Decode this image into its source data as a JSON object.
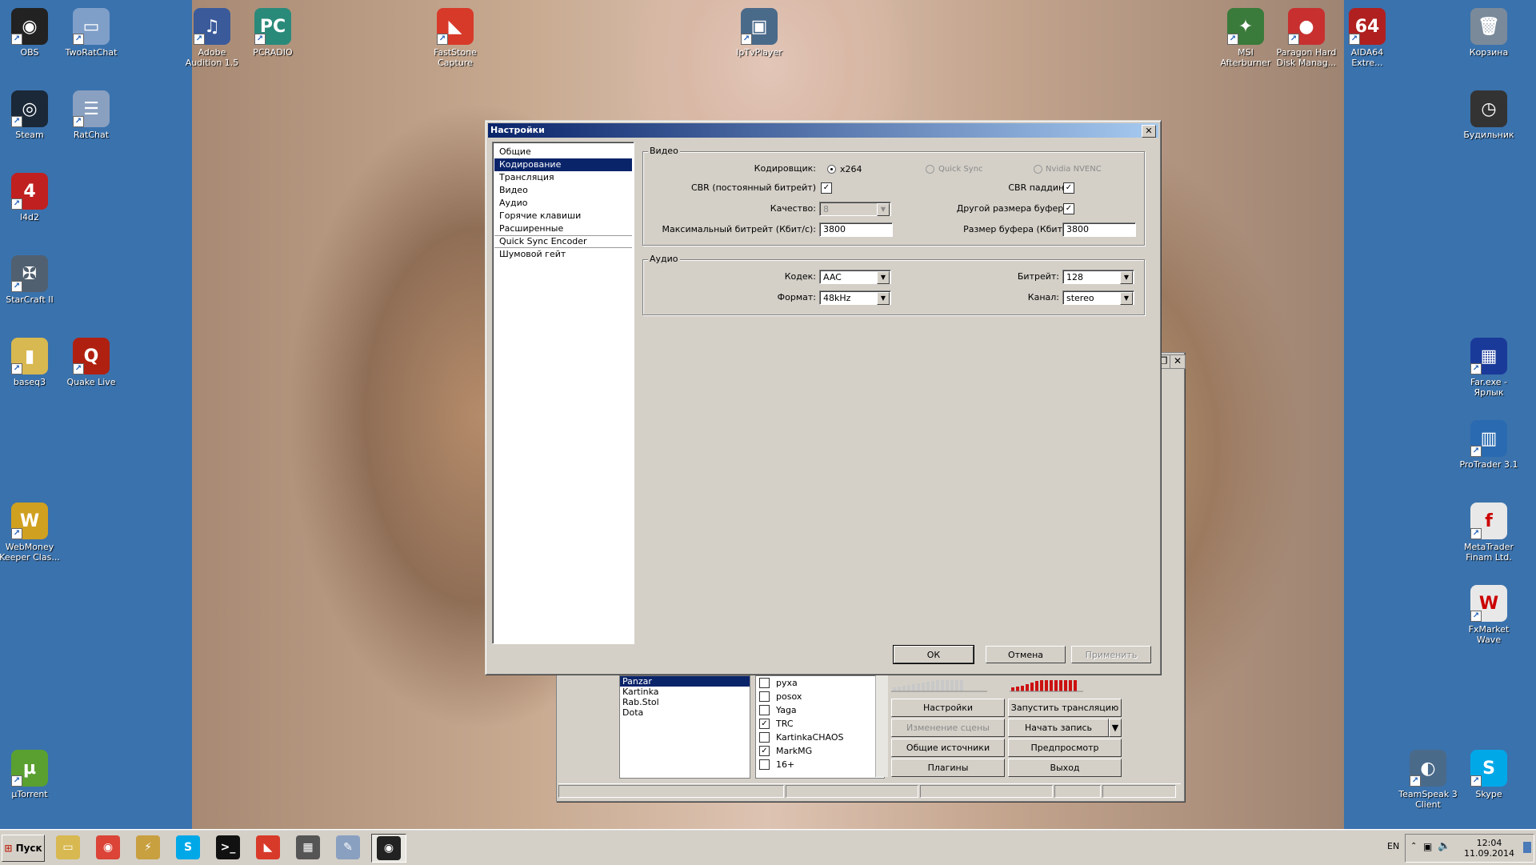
{
  "desktop": {
    "icons": [
      {
        "label": "OBS",
        "color": "#222222",
        "glyph": "◉"
      },
      {
        "label": "TwoRatChat",
        "color": "#7f9fc9",
        "glyph": "▭"
      },
      {
        "label": "Adobe Audition 1.5",
        "color": "#3a5a9a",
        "glyph": "♫"
      },
      {
        "label": "PCRADIO",
        "color": "#2a8a7a",
        "glyph": "PC"
      },
      {
        "label": "FastStone Capture",
        "color": "#d83a2a",
        "glyph": "◣"
      },
      {
        "label": "IpTvPlayer",
        "color": "#4a6a8a",
        "glyph": "▣"
      },
      {
        "label": "MSI Afterburner",
        "color": "#3a7a3a",
        "glyph": "✦"
      },
      {
        "label": "Paragon Hard Disk Manag...",
        "color": "#c83030",
        "glyph": "●"
      },
      {
        "label": "AIDA64 Extre...",
        "color": "#b02020",
        "glyph": "64"
      },
      {
        "label": "Корзина",
        "color": "#7a8a9a",
        "glyph": "🗑"
      },
      {
        "label": "Steam",
        "color": "#1b2838",
        "glyph": "◎"
      },
      {
        "label": "RatChat",
        "color": "#8aa0c0",
        "glyph": "☰"
      },
      {
        "label": "Будильник",
        "color": "#333333",
        "glyph": "◷"
      },
      {
        "label": "l4d2",
        "color": "#c02020",
        "glyph": "4"
      },
      {
        "label": "StarCraft II",
        "color": "#506070",
        "glyph": "✠"
      },
      {
        "label": "baseq3",
        "color": "#d8b850",
        "glyph": "▮"
      },
      {
        "label": "Quake Live",
        "color": "#b02010",
        "glyph": "Q"
      },
      {
        "label": "Far.exe - Ярлык",
        "color": "#1a3a9a",
        "glyph": "▦"
      },
      {
        "label": "ProTrader 3.1",
        "color": "#2a6ab0",
        "glyph": "▥"
      },
      {
        "label": "WebMoney Keeper Clas...",
        "color": "#d0a020",
        "glyph": "W"
      },
      {
        "label": "MetaTrader Finam Ltd.",
        "color": "#e8e8e8",
        "glyph": "f"
      },
      {
        "label": "FxMarket Wave",
        "color": "#e8e8e8",
        "glyph": "W"
      },
      {
        "label": "µTorrent",
        "color": "#5aa030",
        "glyph": "µ"
      },
      {
        "label": "TeamSpeak 3 Client",
        "color": "#4a6a8a",
        "glyph": "◐"
      },
      {
        "label": "Skype",
        "color": "#00a8e8",
        "glyph": "S"
      }
    ]
  },
  "obs": {
    "scenes": [
      "Panzar",
      "Kartinka",
      "Rab.Stol",
      "Dota"
    ],
    "sources": [
      {
        "label": "руха",
        "checked": false
      },
      {
        "label": "posox",
        "checked": false
      },
      {
        "label": "Yaga",
        "checked": false
      },
      {
        "label": "TRC",
        "checked": true
      },
      {
        "label": "KartinkaCHAOS",
        "checked": false
      },
      {
        "label": "MarkMG",
        "checked": true
      },
      {
        "label": "16+",
        "checked": false
      }
    ],
    "buttons": {
      "settings": "Настройки",
      "start_stream": "Запустить трансляцию",
      "edit_scene": "Изменение сцены",
      "start_record": "Начать запись",
      "global_sources": "Общие источники",
      "preview": "Предпросмотр",
      "plugins": "Плагины",
      "exit": "Выход"
    }
  },
  "dialog": {
    "title": "Настройки",
    "nav": [
      "Общие",
      "Кодирование",
      "Трансляция",
      "Видео",
      "Аудио",
      "Горячие клавиши",
      "Расширенные",
      "Quick Sync Encoder",
      "Шумовой гейт"
    ],
    "selected_nav": "Кодирование",
    "video": {
      "legend": "Видео",
      "encoder_label": "Кодировщик:",
      "encoder_options": [
        "x264",
        "Quick Sync",
        "Nvidia NVENC"
      ],
      "encoder_selected": "x264",
      "cbr_label": "CBR (постоянный битрейт)",
      "cbr_checked": true,
      "cbr_padding_label": "CBR паддинг",
      "cbr_padding_checked": true,
      "quality_label": "Качество:",
      "quality_value": "8",
      "custom_buffer_label": "Другой размера буфера",
      "custom_buffer_checked": true,
      "max_bitrate_label": "Максимальный битрейт (Кбит/с):",
      "max_bitrate_value": "3800",
      "buffer_size_label": "Размер буфера (Кбит):",
      "buffer_size_value": "3800"
    },
    "audio": {
      "legend": "Аудио",
      "codec_label": "Кодек:",
      "codec_value": "AAC",
      "bitrate_label": "Битрейт:",
      "bitrate_value": "128",
      "format_label": "Формат:",
      "format_value": "48kHz",
      "channel_label": "Канал:",
      "channel_value": "stereo"
    },
    "buttons": {
      "ok": "ОК",
      "cancel": "Отмена",
      "apply": "Применить"
    }
  },
  "taskbar": {
    "start_label": "Пуск",
    "apps": [
      {
        "name": "explorer",
        "color": "#d8b850",
        "glyph": "▭"
      },
      {
        "name": "chrome",
        "color": "#db4437",
        "glyph": "◉"
      },
      {
        "name": "winamp",
        "color": "#c8a040",
        "glyph": "⚡"
      },
      {
        "name": "skype",
        "color": "#00a8e8",
        "glyph": "S"
      },
      {
        "name": "cmd",
        "color": "#111111",
        "glyph": ">_"
      },
      {
        "name": "faststone",
        "color": "#d83a2a",
        "glyph": "◣"
      },
      {
        "name": "media-player",
        "color": "#555555",
        "glyph": "▦"
      },
      {
        "name": "paint",
        "color": "#8aa0c0",
        "glyph": "✎"
      },
      {
        "name": "obs",
        "color": "#222222",
        "glyph": "◉"
      }
    ],
    "lang": "EN",
    "time": "12:04",
    "date": "11.09.2014"
  }
}
